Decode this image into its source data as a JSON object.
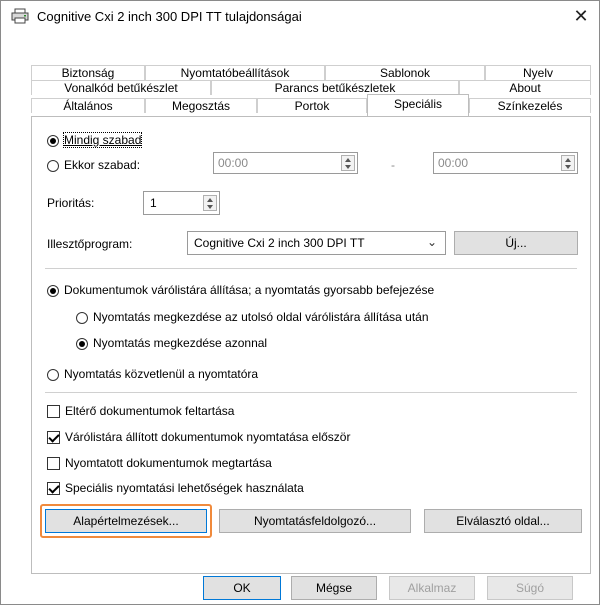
{
  "window": {
    "title": "Cognitive Cxi 2 inch 300 DPI TT tulajdonságai",
    "close_glyph": "✕"
  },
  "tabs": {
    "row1": [
      "Biztonság",
      "Nyomtatóbeállítások",
      "Sablonok",
      "Nyelv"
    ],
    "row2": [
      "Vonalkód betűkészlet",
      "Parancs betűkészletek",
      "About"
    ],
    "row3": [
      "Általános",
      "Megosztás",
      "Portok",
      "Speciális",
      "Színkezelés"
    ],
    "active": "Speciális"
  },
  "availability": {
    "always_label": "Mindig szabad",
    "from_label": "Ekkor szabad:",
    "from_time": "00:00",
    "dash": "-",
    "to_time": "00:00"
  },
  "priority": {
    "label": "Prioritás:",
    "value": "1"
  },
  "driver": {
    "label": "Illesztőprogram:",
    "value": "Cognitive Cxi 2 inch 300 DPI TT",
    "new_button": "Új..."
  },
  "spool": {
    "spool_label": "Dokumentumok várólistára állítása; a nyomtatás gyorsabb befejezése",
    "after_last_page_label": "Nyomtatás megkezdése az utolsó oldal várólistára állítása után",
    "immediately_label": "Nyomtatás megkezdése azonnal",
    "direct_label": "Nyomtatás közvetlenül a nyomtatóra"
  },
  "options": {
    "hold_mismatched": "Eltérő dokumentumok feltartása",
    "print_spooled_first": "Várólistára állított dokumentumok nyomtatása először",
    "keep_printed": "Nyomtatott dokumentumok megtartása",
    "enable_advanced": "Speciális nyomtatási lehetőségek használata"
  },
  "panel_buttons": {
    "defaults": "Alapértelmezések...",
    "processor": "Nyomtatásfeldolgozó...",
    "separator_page": "Elválasztó oldal..."
  },
  "footer": {
    "ok": "OK",
    "cancel": "Mégse",
    "apply": "Alkalmaz",
    "help": "Súgó"
  },
  "colors": {
    "highlight": "#f08a3c",
    "focus": "#0078d7"
  }
}
